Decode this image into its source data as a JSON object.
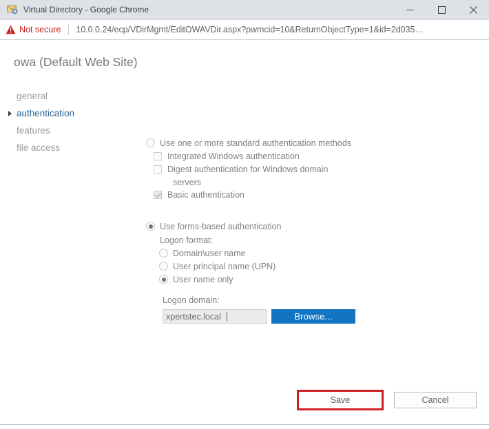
{
  "window": {
    "title": "Virtual Directory - Google Chrome",
    "favicon": "mail-gear-icon",
    "minimize_label": "Minimize",
    "maximize_label": "Maximize",
    "close_label": "Close"
  },
  "omnibox": {
    "warning_icon": "warning-triangle-icon",
    "security_label": "Not secure",
    "url": "10.0.0.24/ecp/VDirMgmt/EditOWAVDir.aspx?pwmcid=10&ReturnObjectType=1&id=2d035…"
  },
  "page": {
    "title": "owa (Default Web Site)",
    "nav": {
      "items": [
        {
          "label": "general",
          "selected": false
        },
        {
          "label": "authentication",
          "selected": true
        },
        {
          "label": "features",
          "selected": false
        },
        {
          "label": "file access",
          "selected": false
        }
      ]
    },
    "auth": {
      "standard": {
        "radio_label": "Use one or more standard authentication methods",
        "radio_checked": false,
        "options": [
          {
            "label": "Integrated Windows authentication",
            "checked": false
          },
          {
            "label": "Digest authentication for Windows domain",
            "label_line2": "servers",
            "checked": false
          },
          {
            "label": "Basic authentication",
            "checked": true
          }
        ]
      },
      "forms": {
        "radio_label": "Use forms-based authentication",
        "radio_checked": true,
        "logon_format_label": "Logon format:",
        "formats": [
          {
            "label": "Domain\\user name",
            "checked": false
          },
          {
            "label": "User principal name (UPN)",
            "checked": false
          },
          {
            "label": "User name only",
            "checked": true
          }
        ],
        "logon_domain_label": "Logon domain:",
        "logon_domain_value": "xpertstec.local",
        "browse_label": "Browse..."
      }
    },
    "actions": {
      "save_label": "Save",
      "cancel_label": "Cancel",
      "save_highlight_color": "#cc1f21"
    }
  },
  "colors": {
    "accent_blue": "#1375c2",
    "nav_selected": "#2a6496",
    "text_gray": "#7d8084",
    "not_secure_red": "#c5221f",
    "titlebar_bg": "#dee1e6"
  }
}
